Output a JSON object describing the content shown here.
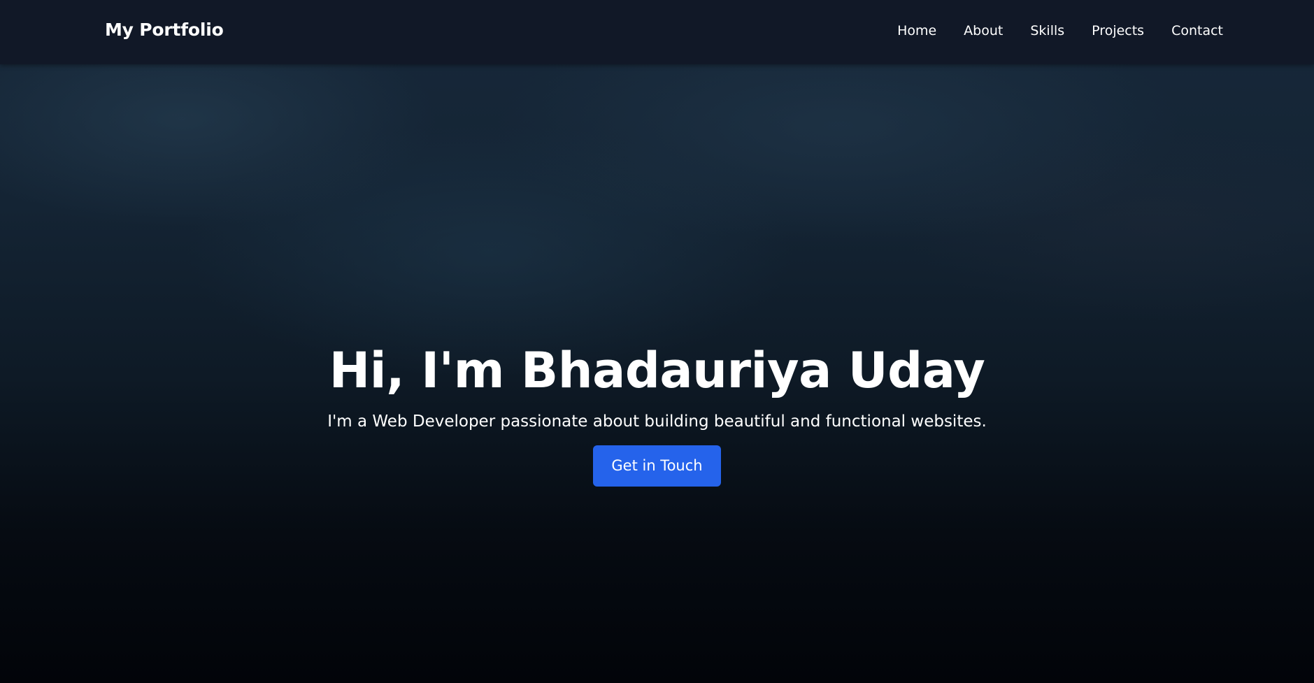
{
  "header": {
    "brand": "My Portfolio",
    "nav": [
      {
        "label": "Home"
      },
      {
        "label": "About"
      },
      {
        "label": "Skills"
      },
      {
        "label": "Projects"
      },
      {
        "label": "Contact"
      }
    ]
  },
  "hero": {
    "title": "Hi, I'm Bhadauriya Uday",
    "subtitle": "I'm a Web Developer passionate about building beautiful and functional websites.",
    "cta_label": "Get in Touch"
  },
  "colors": {
    "header_bg": "#111827",
    "accent": "#2563eb",
    "text": "#ffffff"
  }
}
